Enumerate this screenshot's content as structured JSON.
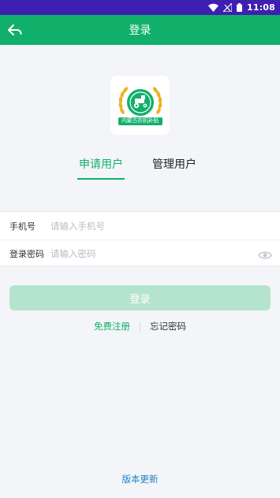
{
  "status_bar": {
    "time": "11:08",
    "icons": [
      "wifi-icon",
      "signal-icon",
      "battery-icon"
    ]
  },
  "app_bar": {
    "title": "登录",
    "back_icon": "back-arrow-icon"
  },
  "logo": {
    "text": "内蒙古农机补贴"
  },
  "tabs": [
    {
      "label": "申请用户",
      "active": true
    },
    {
      "label": "管理用户",
      "active": false
    }
  ],
  "form": {
    "phone": {
      "label": "手机号",
      "placeholder": "请输入手机号"
    },
    "password": {
      "label": "登录密码",
      "placeholder": "请输入密码"
    }
  },
  "login_button": "登录",
  "links": {
    "register": "免费注册",
    "forgot": "忘记密码"
  },
  "version_link": "版本更新",
  "colors": {
    "primary": "#10b06a",
    "status_bar": "#3f1fb0",
    "button_disabled": "#b5e4cc",
    "link_blue": "#1f7fc4",
    "background": "#f3f5f8"
  }
}
